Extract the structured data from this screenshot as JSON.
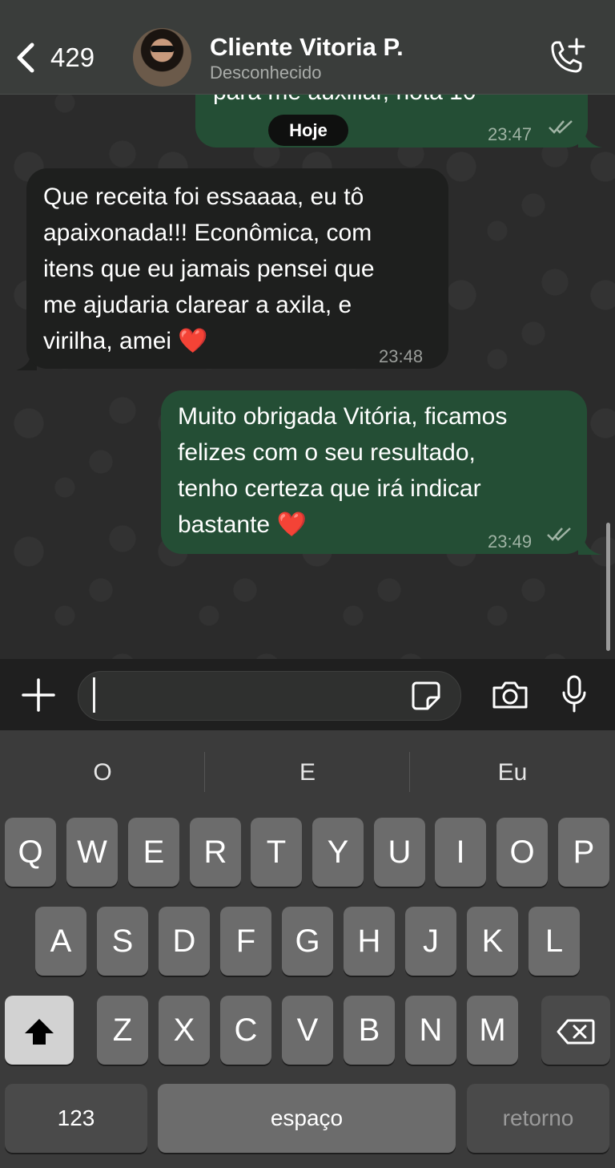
{
  "header": {
    "back_count": "429",
    "contact_name": "Cliente Vitoria P.",
    "contact_status": "Desconhecido",
    "icons": [
      "chevron-left-icon",
      "add-call-icon"
    ]
  },
  "chat": {
    "date_pill": "Hoje",
    "cut_message": {
      "partial_text": "para me auxiliar, nota 10",
      "time": "23:47"
    },
    "messages": [
      {
        "direction": "in",
        "lines": [
          "Que receita foi essaaaa, eu tô",
          "apaixonada!!! Econômica, com",
          "itens que eu jamais pensei que",
          "me ajudaria clarear a axila, e",
          "virilha, amei"
        ],
        "emoji": "❤️",
        "time": "23:48"
      },
      {
        "direction": "out",
        "lines": [
          "Muito obrigada Vitória, ficamos",
          "felizes com o seu resultado,",
          "tenho certeza que irá indicar",
          "bastante"
        ],
        "emoji": "❤️",
        "time": "23:49"
      }
    ]
  },
  "composer": {
    "icons": [
      "plus-icon",
      "sticker-icon",
      "camera-icon",
      "microphone-icon"
    ],
    "input_value": ""
  },
  "keyboard": {
    "suggestions": [
      "O",
      "E",
      "Eu"
    ],
    "row1": [
      "Q",
      "W",
      "E",
      "R",
      "T",
      "Y",
      "U",
      "I",
      "O",
      "P"
    ],
    "row2": [
      "A",
      "S",
      "D",
      "F",
      "G",
      "H",
      "J",
      "K",
      "L"
    ],
    "row3": [
      "Z",
      "X",
      "C",
      "V",
      "B",
      "N",
      "M"
    ],
    "numbers_label": "123",
    "space_label": "espaço",
    "return_label": "retorno"
  },
  "colors": {
    "outgoing_bubble": "#244e35",
    "incoming_bubble": "#1e1f1e",
    "heart": "#e0202e"
  }
}
